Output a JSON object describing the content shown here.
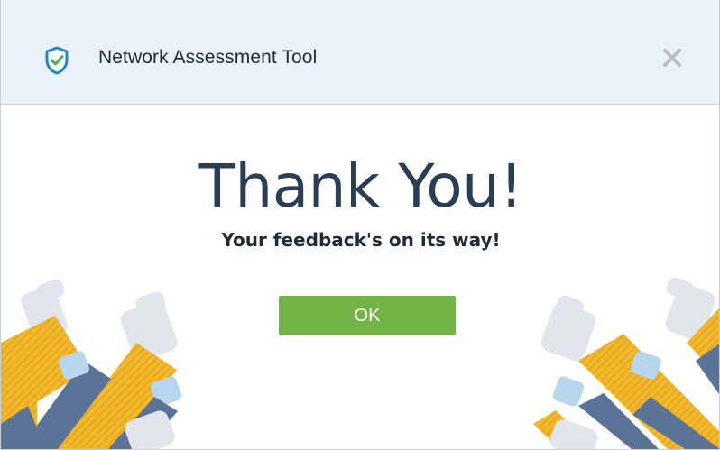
{
  "window": {
    "title": "Network Assessment Tool",
    "icon": "shield-check-icon",
    "close_icon": "close-icon"
  },
  "dialog": {
    "heading": "Thank You!",
    "subheading": "Your feedback's on its way!",
    "ok_label": "OK"
  },
  "colors": {
    "titlebar_bg": "#eaf2fa",
    "ok_button": "#72b446",
    "heading_text": "#2c3e55",
    "shield_blue": "#1e88c8",
    "shield_check": "#4caf50",
    "sleeve_yellow": "#f2b92f",
    "sleeve_blue": "#5a7397",
    "hand_grey": "#e2e6ec",
    "hand_lightblue": "#b8d7ee"
  },
  "decoration": {
    "left": "thumbs-up-hands-illustration",
    "right": "thumbs-up-hands-illustration"
  }
}
